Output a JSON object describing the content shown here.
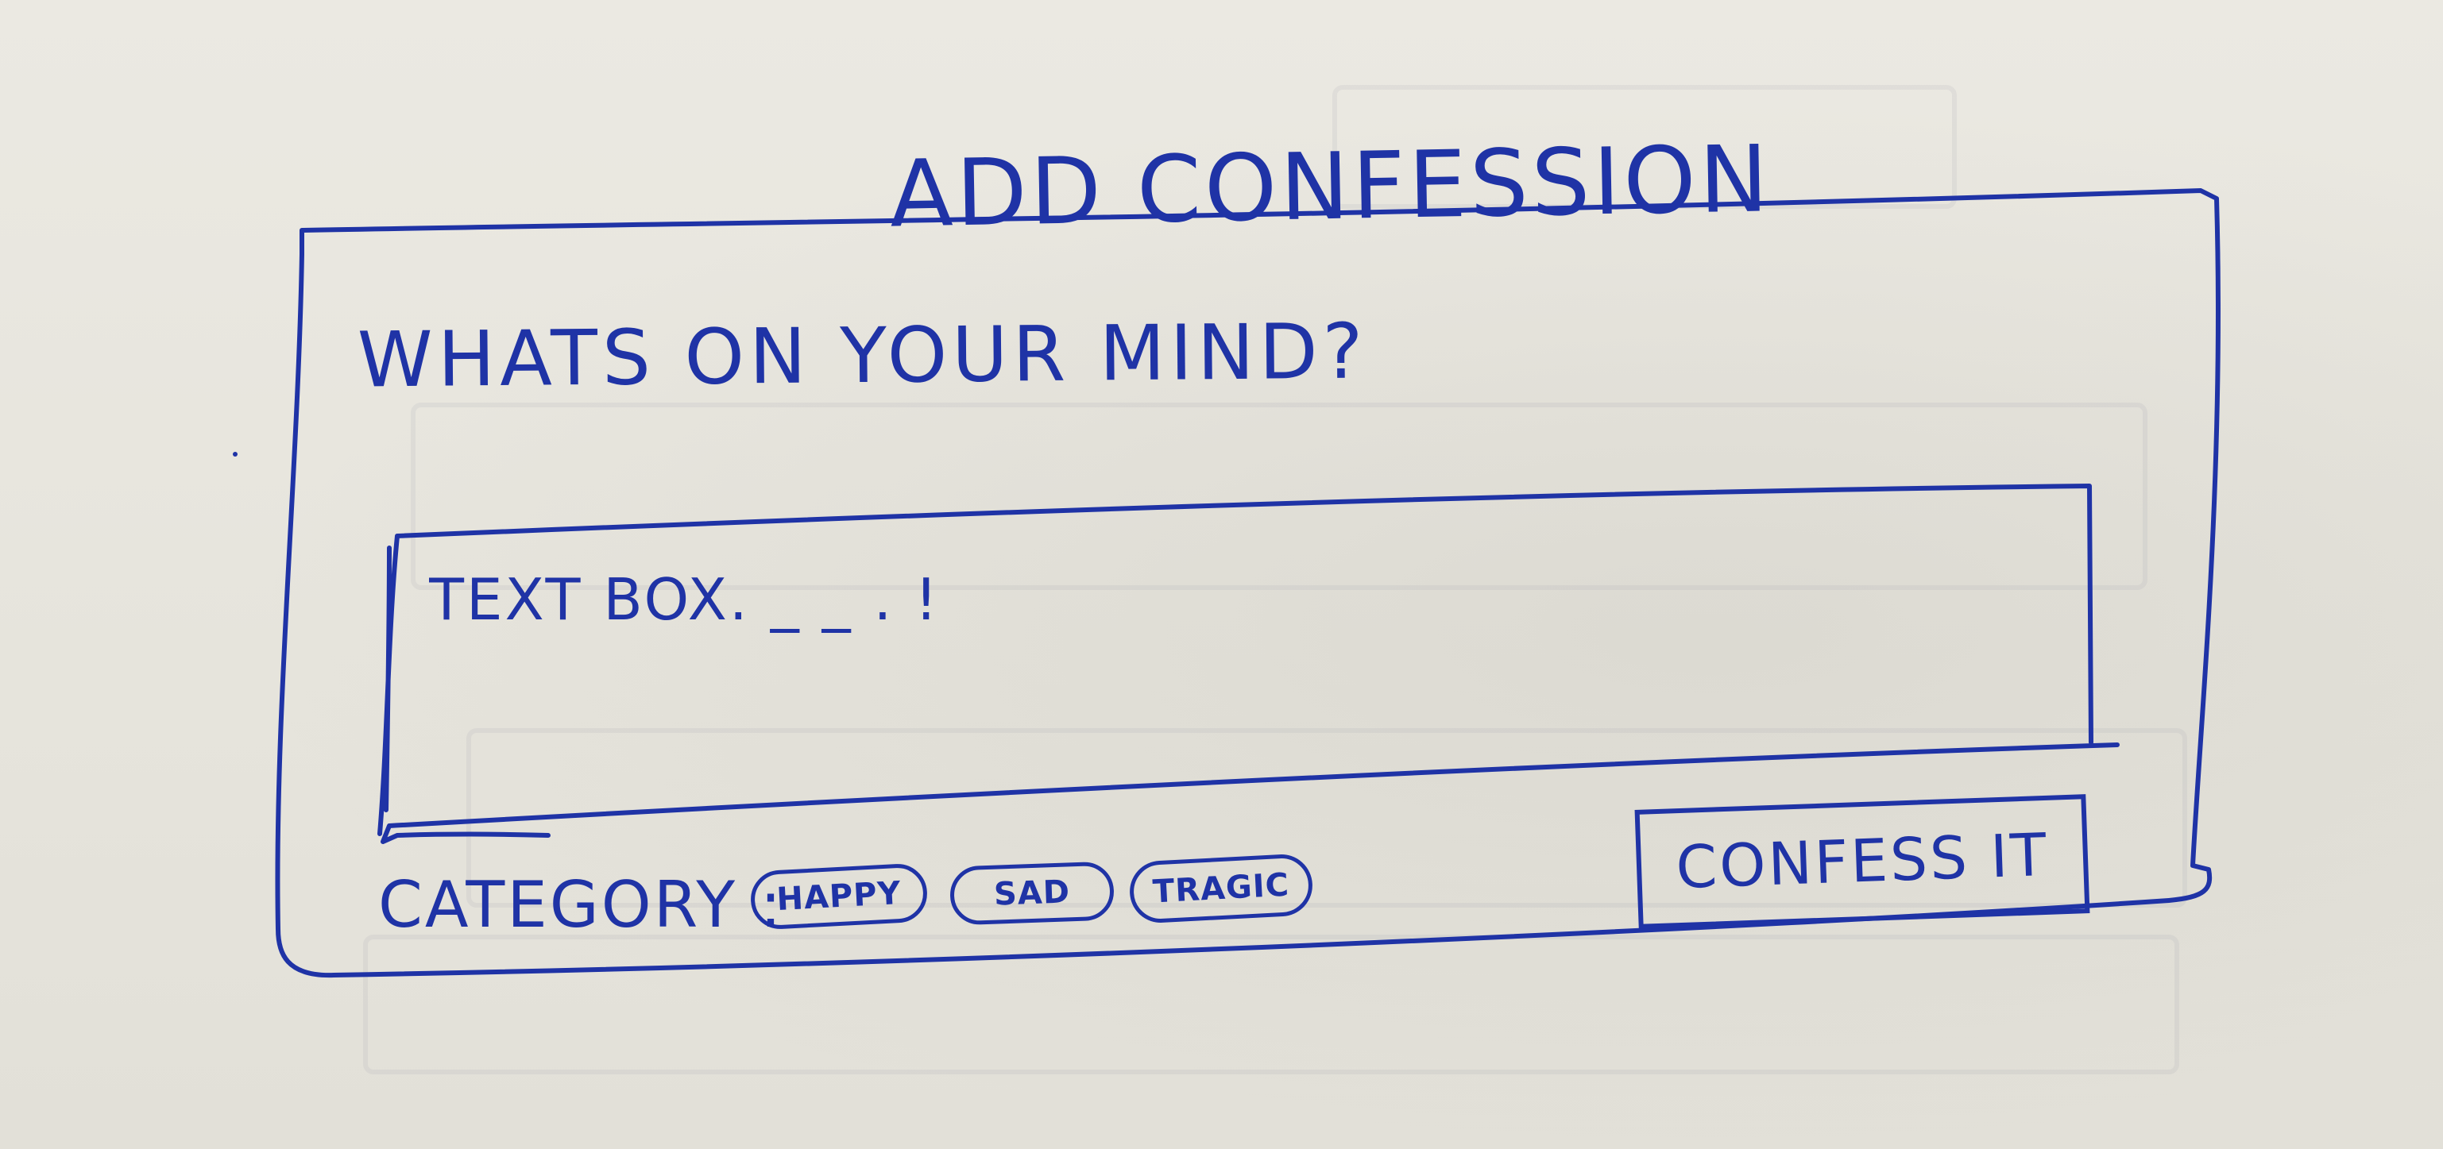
{
  "dialog": {
    "title": "ADD CONFESSION",
    "prompt": "WHATS ON YOUR MIND?",
    "textbox": {
      "placeholder": "TEXT BOX. _ _ . !"
    },
    "category": {
      "label": "CATEGORY :",
      "options": [
        "HAPPY",
        "SAD",
        "TRAGIC"
      ]
    },
    "submit_label": "CONFESS IT"
  },
  "colors": {
    "ink": "#1f33a6",
    "paper": "#e8e6df"
  }
}
